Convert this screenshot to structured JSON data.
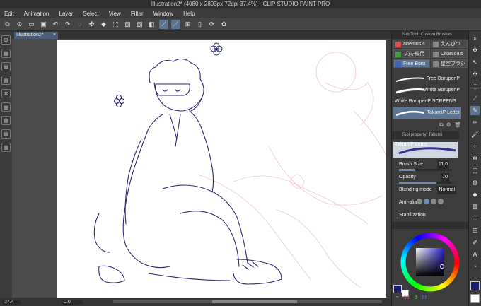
{
  "window": {
    "title": "Illustration2* (4080 x 2803px 72dpi 37.4%) - CLIP STUDIO PAINT PRO"
  },
  "menu": [
    "Edit",
    "Animation",
    "Layer",
    "Select",
    "View",
    "Filter",
    "Window",
    "Help"
  ],
  "document_tab": {
    "label": "Illustration2*",
    "close": "×"
  },
  "subtool_panel": {
    "title": "Sub Tool: Custom Brushes",
    "buttons": [
      {
        "label": "artemus c",
        "selected": false,
        "icon_color": "#e05050"
      },
      {
        "label": "えんぴつ",
        "selected": false,
        "icon_color": "#888888"
      },
      {
        "label": "ブ丸-校用",
        "selected": false,
        "icon_color": "#40a040"
      },
      {
        "label": "Charcoals",
        "selected": false,
        "icon_color": "#888888"
      },
      {
        "label": "Free Boru",
        "selected": true,
        "icon_color": "#4060c0"
      },
      {
        "label": "星空ブラシ",
        "selected": false,
        "icon_color": "#888888"
      }
    ]
  },
  "brush_list": [
    {
      "label": "Free BorupenP",
      "selected": false
    },
    {
      "label": "White BorupenP",
      "selected": false
    },
    {
      "label": "White BorupenP SCREENS",
      "selected": false
    },
    {
      "label": "TakumiP Letter",
      "selected": true
    }
  ],
  "tool_property": {
    "title": "Tool property: Takumi",
    "preview_label": "TakumiP Letter",
    "brush_size_label": "Brush Size",
    "brush_size_value": "11.0",
    "brush_size_fraction": 0.3,
    "opacity_label": "Opacity",
    "opacity_value": "70",
    "opacity_fraction": 0.7,
    "blending_label": "Blending mode",
    "blending_value": "Normal",
    "antialias_label": "Anti-alias",
    "stabilization_label": "Stabilization"
  },
  "color": {
    "main_color": "#1a1e6e",
    "sub_color": "#ffffff",
    "h": "16",
    "s": "6",
    "v": "86"
  },
  "status": {
    "zoom": "37.4",
    "rotation": "0.0"
  },
  "accent": "#5d7593"
}
